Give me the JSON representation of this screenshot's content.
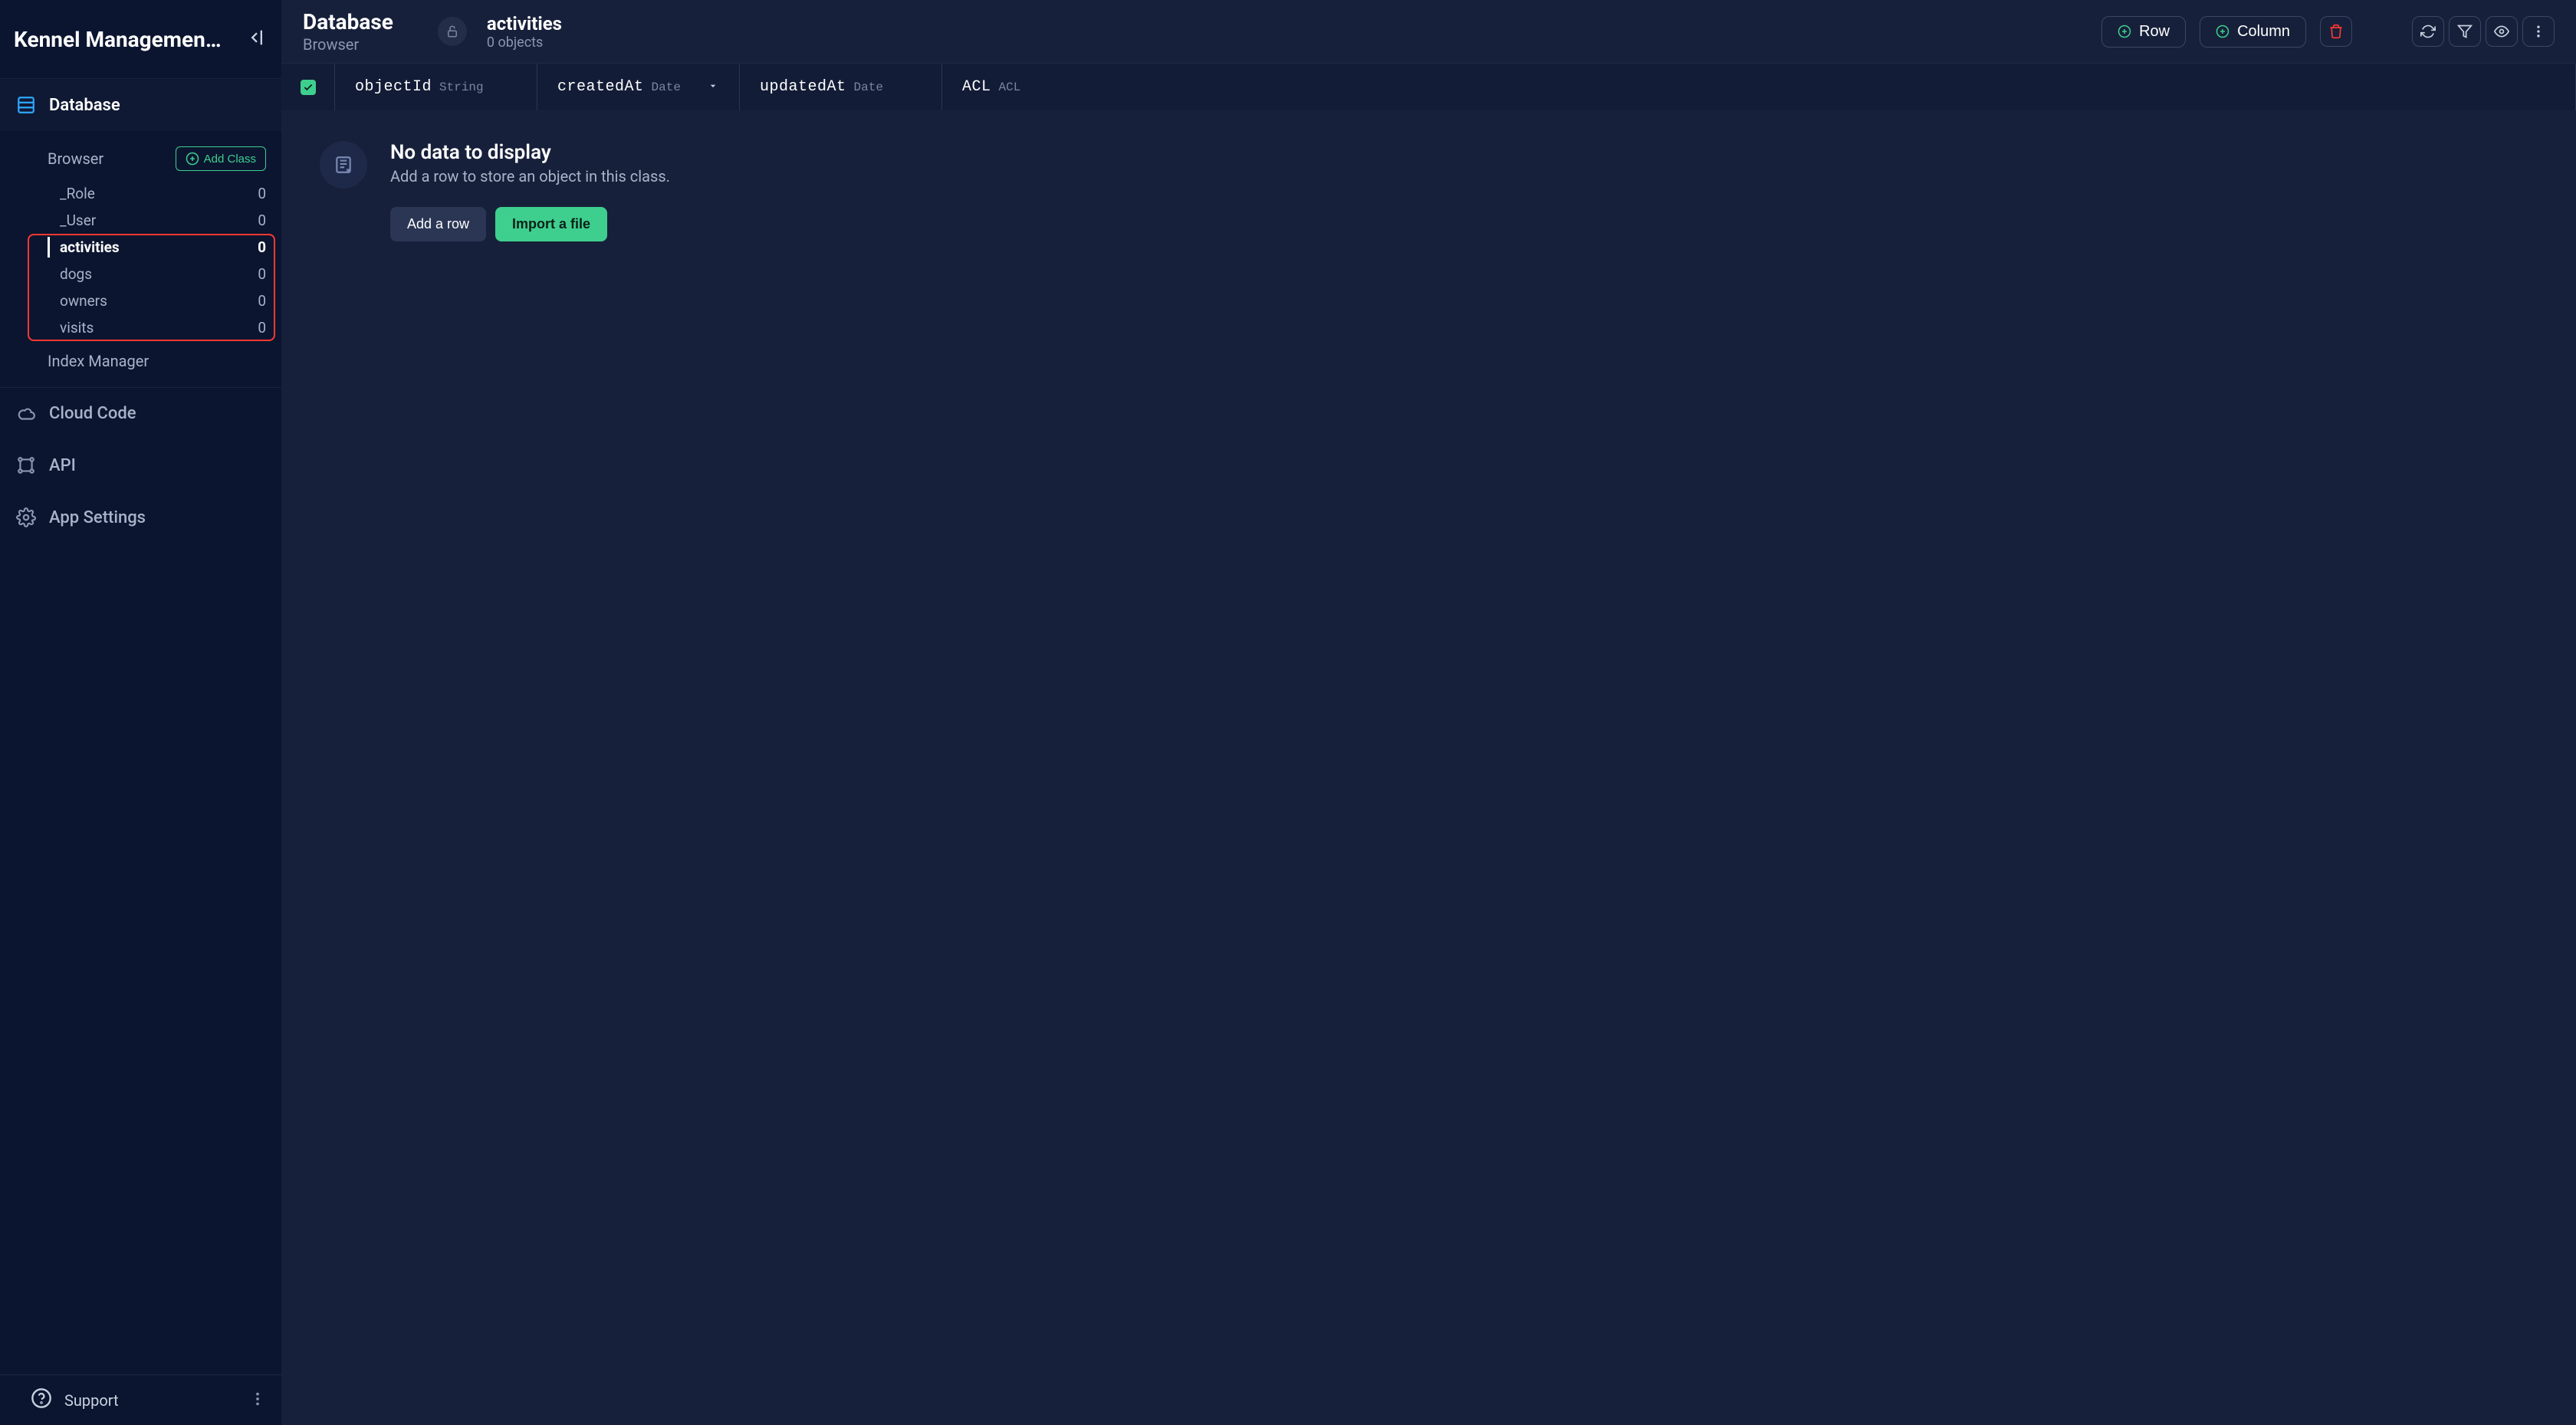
{
  "app_name": "Kennel Management …",
  "sidebar": {
    "database_label": "Database",
    "browser_label": "Browser",
    "add_class_label": "Add Class",
    "classes": [
      {
        "name": "_Role",
        "count": "0",
        "active": false
      },
      {
        "name": "_User",
        "count": "0",
        "active": false
      },
      {
        "name": "activities",
        "count": "0",
        "active": true
      },
      {
        "name": "dogs",
        "count": "0",
        "active": false
      },
      {
        "name": "owners",
        "count": "0",
        "active": false
      },
      {
        "name": "visits",
        "count": "0",
        "active": false
      }
    ],
    "index_manager_label": "Index Manager",
    "cloud_code_label": "Cloud Code",
    "api_label": "API",
    "app_settings_label": "App Settings",
    "support_label": "Support"
  },
  "header": {
    "title": "Database",
    "subtitle": "Browser",
    "class_name": "activities",
    "object_count": "0 objects",
    "row_btn": "Row",
    "column_btn": "Column"
  },
  "columns": [
    {
      "name": "objectId",
      "type": "String",
      "sortable": false
    },
    {
      "name": "createdAt",
      "type": "Date",
      "sortable": true
    },
    {
      "name": "updatedAt",
      "type": "Date",
      "sortable": false
    },
    {
      "name": "ACL",
      "type": "ACL",
      "sortable": false
    }
  ],
  "empty": {
    "title": "No data to display",
    "message": "Add a row to store an object in this class.",
    "add_row_btn": "Add a row",
    "import_file_btn": "Import a file"
  }
}
